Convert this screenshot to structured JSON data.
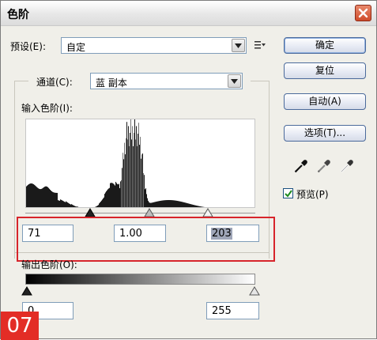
{
  "window": {
    "title": "色阶"
  },
  "preset": {
    "label": "预设(E):",
    "value": "自定"
  },
  "channel": {
    "label": "通道(C):",
    "value": "蓝 副本"
  },
  "input_levels": {
    "label": "输入色阶(I):",
    "black": "71",
    "gamma": "1.00",
    "white": "203"
  },
  "output_levels": {
    "label": "输出色阶(O):",
    "black": "0",
    "white": "255"
  },
  "buttons": {
    "ok": "确定",
    "reset": "复位",
    "auto": "自动(A)",
    "options": "选项(T)..."
  },
  "preview": {
    "label": "预览(P)",
    "checked": true
  },
  "badge": {
    "text": "07"
  },
  "colors": {
    "highlight": "#d7242b",
    "badge": "#e32d26"
  }
}
